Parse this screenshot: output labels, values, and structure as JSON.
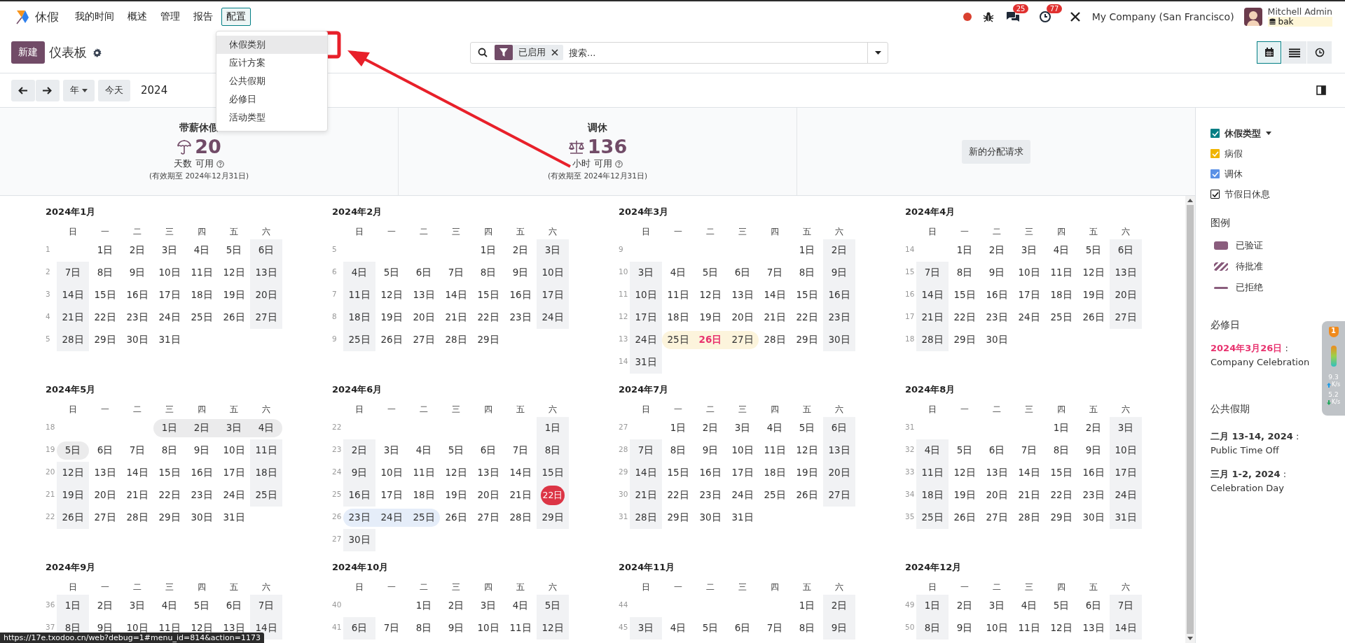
{
  "navbar": {
    "app": "休假",
    "menu": [
      {
        "label": "我的时间",
        "selected": false
      },
      {
        "label": "概述",
        "selected": false
      },
      {
        "label": "管理",
        "selected": false
      },
      {
        "label": "报告",
        "selected": false
      },
      {
        "label": "配置",
        "selected": true
      }
    ],
    "dropdown": [
      {
        "label": "休假类别",
        "selected": true
      },
      {
        "label": "应计方案",
        "selected": false
      },
      {
        "label": "公共假期",
        "selected": false
      },
      {
        "label": "必修日",
        "selected": false
      },
      {
        "label": "活动类型",
        "selected": false
      }
    ],
    "messages_badge": "25",
    "activities_badge": "77",
    "company": "My Company (San Francisco)",
    "user": "Mitchell Admin",
    "database": "bak"
  },
  "control_panel": {
    "new_button": "新建",
    "title": "仪表板",
    "facet": "已启用",
    "search_placeholder": "搜索...",
    "views": [
      {
        "kind": "calendar",
        "selected": true
      },
      {
        "kind": "list",
        "selected": false
      },
      {
        "kind": "activity",
        "selected": false
      }
    ],
    "scale": "年",
    "today_button": "今天",
    "period": "2024"
  },
  "summary": {
    "cards": [
      {
        "title": "带薪休假",
        "value": "20",
        "unit": "天数 可用",
        "validity": "(有效期至 2024年12月31日)"
      },
      {
        "title": "调休",
        "value": "136",
        "unit": "小时 可用",
        "validity": "(有效期至 2024年12月31日)"
      }
    ],
    "button": "新的分配请求"
  },
  "months": [
    {
      "title": "2024年1月",
      "weekdays": [
        "日",
        "一",
        "二",
        "三",
        "四",
        "五",
        "六"
      ],
      "weeks": [
        {
          "no": "1",
          "days": [
            "1日",
            "2日",
            "3日",
            "4日",
            "5日",
            "6日"
          ]
        },
        {
          "no": "2",
          "days": [
            "7日",
            "8日",
            "9日",
            "10日",
            "11日",
            "12日",
            "13日"
          ]
        },
        {
          "no": "3",
          "days": [
            "14日",
            "15日",
            "16日",
            "17日",
            "18日",
            "19日",
            "20日"
          ]
        },
        {
          "no": "4",
          "days": [
            "21日",
            "22日",
            "23日",
            "24日",
            "25日",
            "26日",
            "27日"
          ]
        },
        {
          "no": "5",
          "days": [
            "28日",
            "29日",
            "30日",
            "31日"
          ]
        }
      ]
    },
    {
      "title": "2024年2月",
      "weekdays": [
        "日",
        "一",
        "二",
        "三",
        "四",
        "五",
        "六"
      ],
      "weeks": [
        {
          "no": "5",
          "days": [
            "1日",
            "2日",
            "3日"
          ]
        },
        {
          "no": "6",
          "days": [
            "4日",
            "5日",
            "6日",
            "7日",
            "8日",
            "9日",
            "10日"
          ]
        },
        {
          "no": "7",
          "days": [
            "11日",
            "12日",
            "13日",
            "14日",
            "15日",
            "16日",
            "17日"
          ]
        },
        {
          "no": "8",
          "days": [
            "18日",
            "19日",
            "20日",
            "21日",
            "22日",
            "23日",
            "24日"
          ]
        },
        {
          "no": "9",
          "days": [
            "25日",
            "26日",
            "27日",
            "28日",
            "29日"
          ]
        }
      ]
    },
    {
      "title": "2024年3月",
      "weekdays": [
        "日",
        "一",
        "二",
        "三",
        "四",
        "五",
        "六"
      ],
      "weeks": [
        {
          "no": "9",
          "days": [
            "1日",
            "2日"
          ]
        },
        {
          "no": "10",
          "days": [
            "3日",
            "4日",
            "5日",
            "6日",
            "7日",
            "8日",
            "9日"
          ]
        },
        {
          "no": "11",
          "days": [
            "10日",
            "11日",
            "12日",
            "13日",
            "14日",
            "15日",
            "16日"
          ]
        },
        {
          "no": "12",
          "days": [
            "17日",
            "18日",
            "19日",
            "20日",
            "21日",
            "22日",
            "23日"
          ]
        },
        {
          "no": "13",
          "days": [
            "24日",
            {
              "label": "25日",
              "color": "#fcf4dc"
            },
            {
              "label": "26日",
              "color": "#fcf4dc",
              "kind": "mandatory"
            },
            {
              "label": "27日",
              "color": "#fcf4dc"
            },
            "28日",
            "29日",
            "30日"
          ]
        },
        {
          "no": "14",
          "days": [
            "31日"
          ]
        }
      ]
    },
    {
      "title": "2024年4月",
      "weekdays": [
        "日",
        "一",
        "二",
        "三",
        "四",
        "五",
        "六"
      ],
      "weeks": [
        {
          "no": "14",
          "days": [
            "1日",
            "2日",
            "3日",
            "4日",
            "5日",
            "6日"
          ]
        },
        {
          "no": "15",
          "days": [
            "7日",
            "8日",
            "9日",
            "10日",
            "11日",
            "12日",
            "13日"
          ]
        },
        {
          "no": "16",
          "days": [
            "14日",
            "15日",
            "16日",
            "17日",
            "18日",
            "19日",
            "20日"
          ]
        },
        {
          "no": "17",
          "days": [
            "21日",
            "22日",
            "23日",
            "24日",
            "25日",
            "26日",
            "27日"
          ]
        },
        {
          "no": "18",
          "days": [
            "28日",
            "29日",
            "30日"
          ]
        }
      ]
    },
    {
      "title": "2024年5月",
      "weekdays": [
        "日",
        "一",
        "二",
        "三",
        "四",
        "五",
        "六"
      ],
      "weeks": [
        {
          "no": "18",
          "days": [
            {
              "label": "1日",
              "color": "#ebebec"
            },
            {
              "label": "2日",
              "color": "#ebebec"
            },
            {
              "label": "3日",
              "color": "#ebebec"
            },
            {
              "label": "4日",
              "color": "#ebebec"
            }
          ]
        },
        {
          "no": "19",
          "days": [
            {
              "label": "5日",
              "color": "#ebebec"
            },
            "6日",
            "7日",
            "8日",
            "9日",
            "10日",
            "11日"
          ]
        },
        {
          "no": "20",
          "days": [
            "12日",
            "13日",
            "14日",
            "15日",
            "16日",
            "17日",
            "18日"
          ]
        },
        {
          "no": "21",
          "days": [
            "19日",
            "20日",
            "21日",
            "22日",
            "23日",
            "24日",
            "25日"
          ]
        },
        {
          "no": "22",
          "days": [
            "26日",
            "27日",
            "28日",
            "29日",
            "30日",
            "31日"
          ]
        }
      ]
    },
    {
      "title": "2024年6月",
      "weekdays": [
        "日",
        "一",
        "二",
        "三",
        "四",
        "五",
        "六"
      ],
      "weeks": [
        {
          "no": "22",
          "days": [
            "1日"
          ]
        },
        {
          "no": "23",
          "days": [
            "2日",
            "3日",
            "4日",
            "5日",
            "6日",
            "7日",
            "8日"
          ]
        },
        {
          "no": "24",
          "days": [
            "9日",
            "10日",
            "11日",
            "12日",
            "13日",
            "14日",
            "15日"
          ]
        },
        {
          "no": "25",
          "days": [
            "16日",
            "17日",
            "18日",
            "19日",
            "20日",
            "21日",
            {
              "label": "22日",
              "kind": "today"
            }
          ]
        },
        {
          "no": "26",
          "days": [
            {
              "label": "23日",
              "color": "#e5edf9"
            },
            {
              "label": "24日",
              "color": "#e5edf9"
            },
            {
              "label": "25日",
              "color": "#e5edf9"
            },
            "26日",
            "27日",
            "28日",
            "29日"
          ]
        },
        {
          "no": "27",
          "days": [
            "30日"
          ]
        }
      ]
    },
    {
      "title": "2024年7月",
      "weekdays": [
        "日",
        "一",
        "二",
        "三",
        "四",
        "五",
        "六"
      ],
      "weeks": [
        {
          "no": "27",
          "days": [
            "1日",
            "2日",
            "3日",
            "4日",
            "5日",
            "6日"
          ]
        },
        {
          "no": "28",
          "days": [
            "7日",
            "8日",
            "9日",
            "10日",
            "11日",
            "12日",
            "13日"
          ]
        },
        {
          "no": "29",
          "days": [
            "14日",
            "15日",
            "16日",
            "17日",
            "18日",
            "19日",
            "20日"
          ]
        },
        {
          "no": "30",
          "days": [
            "21日",
            "22日",
            "23日",
            "24日",
            "25日",
            "26日",
            "27日"
          ]
        },
        {
          "no": "31",
          "days": [
            "28日",
            "29日",
            "30日",
            "31日"
          ]
        }
      ]
    },
    {
      "title": "2024年8月",
      "weekdays": [
        "日",
        "一",
        "二",
        "三",
        "四",
        "五",
        "六"
      ],
      "weeks": [
        {
          "no": "31",
          "days": [
            "1日",
            "2日",
            "3日"
          ]
        },
        {
          "no": "32",
          "days": [
            "4日",
            "5日",
            "6日",
            "7日",
            "8日",
            "9日",
            "10日"
          ]
        },
        {
          "no": "33",
          "days": [
            "11日",
            "12日",
            "13日",
            "14日",
            "15日",
            "16日",
            "17日"
          ]
        },
        {
          "no": "34",
          "days": [
            "18日",
            "19日",
            "20日",
            "21日",
            "22日",
            "23日",
            "24日"
          ]
        },
        {
          "no": "35",
          "days": [
            "25日",
            "26日",
            "27日",
            "28日",
            "29日",
            "30日",
            "31日"
          ]
        }
      ]
    },
    {
      "title": "2024年9月",
      "weekdays": [
        "日",
        "一",
        "二",
        "三",
        "四",
        "五",
        "六"
      ],
      "weeks": [
        {
          "no": "36",
          "days": [
            "1日",
            "2日",
            "3日",
            "4日",
            "5日",
            "6日",
            "7日"
          ]
        },
        {
          "no": "37",
          "days": [
            "8日",
            "9日",
            "10日",
            "11日",
            "12日",
            "13日",
            "14日"
          ]
        }
      ]
    },
    {
      "title": "2024年10月",
      "weekdays": [
        "日",
        "一",
        "二",
        "三",
        "四",
        "五",
        "六"
      ],
      "weeks": [
        {
          "no": "40",
          "days": [
            "1日",
            "2日",
            "3日",
            "4日",
            "5日"
          ]
        },
        {
          "no": "41",
          "days": [
            "6日",
            "7日",
            "8日",
            "9日",
            "10日",
            "11日",
            "12日"
          ]
        }
      ]
    },
    {
      "title": "2024年11月",
      "weekdays": [
        "日",
        "一",
        "二",
        "三",
        "四",
        "五",
        "六"
      ],
      "weeks": [
        {
          "no": "44",
          "days": [
            "1日",
            "2日"
          ]
        },
        {
          "no": "45",
          "days": [
            "3日",
            "4日",
            "5日",
            "6日",
            "7日",
            "8日",
            "9日"
          ]
        }
      ]
    },
    {
      "title": "2024年12月",
      "weekdays": [
        "日",
        "一",
        "二",
        "三",
        "四",
        "五",
        "六"
      ],
      "weeks": [
        {
          "no": "49",
          "days": [
            "1日",
            "2日",
            "3日",
            "4日",
            "5日",
            "6日",
            "7日"
          ]
        },
        {
          "no": "50",
          "days": [
            "8日",
            "9日",
            "10日",
            "11日",
            "12日",
            "13日",
            "14日"
          ]
        }
      ]
    }
  ],
  "sidebar": {
    "filters": [
      {
        "label": "休假类型",
        "kind": "header",
        "checked": true,
        "color": "#017e84"
      },
      {
        "label": "病假",
        "kind": "item",
        "checked": true,
        "color": "#f0b400"
      },
      {
        "label": "调休",
        "kind": "item",
        "checked": true,
        "color": "#5b91e6"
      },
      {
        "label": "节假日休息",
        "kind": "item",
        "checked": true,
        "color": "#ffffff"
      }
    ],
    "legend_title": "图例",
    "legend": [
      {
        "label": "已验证",
        "kind": "solid"
      },
      {
        "label": "待批准",
        "kind": "striped"
      },
      {
        "label": "已拒绝",
        "kind": "line"
      }
    ],
    "mandatory_title": "必修日",
    "mandatory": [
      {
        "date": "2024年3月26日",
        "text": " : Company Celebration"
      }
    ],
    "holidays_title": "公共假期",
    "holidays": [
      {
        "date": "二月 13-14, 2024",
        "text": " : Public Time Off"
      },
      {
        "date": "三月 1-2, 2024",
        "text": " : Celebration Day"
      }
    ]
  },
  "network_widget": {
    "badge": "1",
    "upload": {
      "value": "9.3",
      "unit": "K/s"
    },
    "download": {
      "value": "5.2",
      "unit": "K/s"
    }
  },
  "status_url": "https://17e.txodoo.cn/web?debug=1#menu_id=814&action=1173"
}
